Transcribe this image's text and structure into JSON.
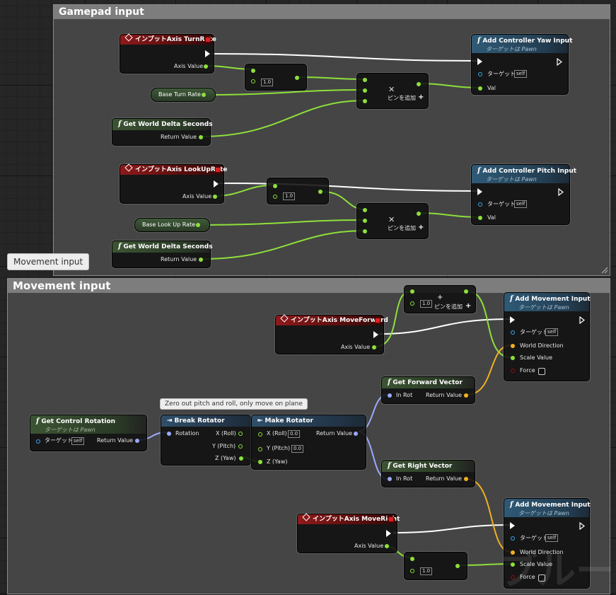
{
  "comments": {
    "gamepad": {
      "title": "Gamepad input"
    },
    "movement": {
      "title": "Movement input",
      "bubble": "Movement input"
    }
  },
  "note": "Zero out pitch and roll, only move on plane",
  "turn_event": {
    "title": "インプットAxis TurnRate",
    "axis_value": "Axis Value"
  },
  "lookup_event": {
    "title": "インプットAxis LookUpRate",
    "axis_value": "Axis Value"
  },
  "forward_event": {
    "title": "インプットAxis MoveForward",
    "axis_value": "Axis Value"
  },
  "right_event": {
    "title": "インプットAxis MoveRight",
    "axis_value": "Axis Value"
  },
  "multiply": {
    "const_value": "1.0",
    "add_pin": "ピンを追加"
  },
  "base_turn_rate": "Base Turn Rate",
  "base_look_up_rate": "Base Look Up Rate",
  "delta_seconds": {
    "title": "Get World Delta Seconds",
    "return": "Return Value"
  },
  "yaw_input": {
    "title": "Add Controller Yaw Input",
    "subtitle": "ターゲットは Pawn",
    "target": "ターゲット",
    "self": "self",
    "val": "Val"
  },
  "pitch_input": {
    "title": "Add Controller Pitch Input",
    "subtitle": "ターゲットは Pawn",
    "target": "ターゲット",
    "self": "self",
    "val": "Val"
  },
  "movement_input": {
    "title": "Add Movement Input",
    "subtitle": "ターゲットは Pawn",
    "target": "ターゲット",
    "self": "self",
    "world_direction": "World Direction",
    "scale_value": "Scale Value",
    "force": "Force"
  },
  "control_rotation": {
    "title": "Get Control Rotation",
    "subtitle": "ターゲットは Pawn",
    "target": "ターゲット",
    "self": "self",
    "return": "Return Value"
  },
  "break_rotator": {
    "title": "Break Rotator",
    "rotation": "Rotation",
    "x": "X (Roll)",
    "y": "Y (Pitch)",
    "z": "Z (Yaw)"
  },
  "make_rotator": {
    "title": "Make Rotator",
    "x": "X (Roll)",
    "y": "Y (Pitch)",
    "z": "Z (Yaw)",
    "x_val": "0.0",
    "y_val": "0.0",
    "return": "Return Value"
  },
  "forward_vector": {
    "title": "Get Forward Vector",
    "in": "In Rot",
    "return": "Return Value"
  },
  "right_vector": {
    "title": "Get Right Vector",
    "in": "In Rot",
    "return": "Return Value"
  },
  "watermark": "ブルー",
  "colors": {
    "float_pin": "#8ee03a",
    "exec": "#ffffff",
    "rotator_pin": "#9aa9ff",
    "vector_pin": "#f0b020",
    "object_pin": "#3aa8f2",
    "event_header": "#8e1a1a",
    "pure_header": "#3c5433",
    "function_header": "#2f5a76"
  }
}
